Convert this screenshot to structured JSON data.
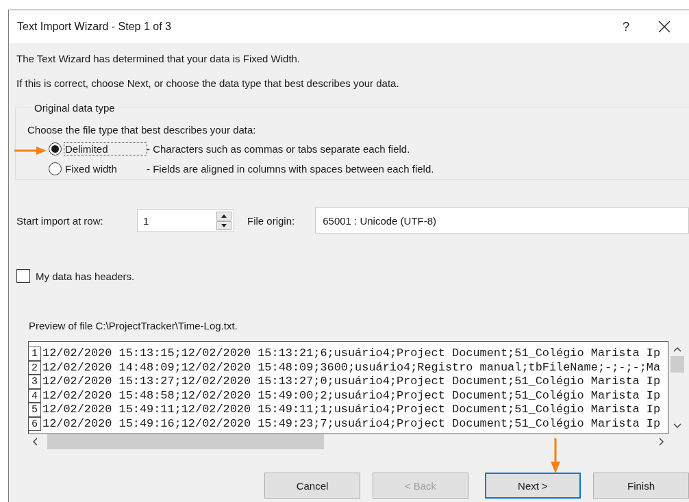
{
  "window": {
    "title": "Text Import Wizard - Step 1 of 3",
    "help": "?"
  },
  "intro": [
    "The Text Wizard has determined that your data is Fixed Width.",
    "If this is correct, choose Next, or choose the data type that best describes your data."
  ],
  "group": {
    "legend": "Original data type",
    "prompt": "Choose the file type that best describes your data:",
    "options": [
      {
        "label": "Delimited",
        "description": "- Characters such as commas or tabs separate each field.",
        "selected": true
      },
      {
        "label": "Fixed width",
        "description": "- Fields are aligned in columns with spaces between each field.",
        "selected": false
      }
    ]
  },
  "start_row": {
    "label": "Start import at row:",
    "value": "1"
  },
  "file_origin": {
    "label": "File origin:",
    "value": "65001 : Unicode (UTF-8)"
  },
  "headers_checkbox": {
    "label": "My data has headers.",
    "checked": false
  },
  "preview": {
    "label": "Preview of file C:\\ProjectTracker\\Time-Log.txt.",
    "rows": [
      {
        "number": "1",
        "text": "12/02/2020 15:13:15;12/02/2020 15:13:21;6;usuário4;Project Document;51_Colégio Marista Ip"
      },
      {
        "number": "2",
        "text": "12/02/2020 14:48:09;12/02/2020 15:48:09;3600;usuário4;Registro manual;tbFileName;-;-;-;Ma"
      },
      {
        "number": "3",
        "text": "12/02/2020 15:13:27;12/02/2020 15:13:27;0;usuário4;Project Document;51_Colégio Marista Ip"
      },
      {
        "number": "4",
        "text": "12/02/2020 15:48:58;12/02/2020 15:49:00;2;usuário4;Project Document;51_Colégio Marista Ip"
      },
      {
        "number": "5",
        "text": "12/02/2020 15:49:11;12/02/2020 15:49:11;1;usuário4;Project Document;51_Colégio Marista Ip"
      },
      {
        "number": "6",
        "text": "12/02/2020 15:49:16;12/02/2020 15:49:23;7;usuário4;Project Document;51_Colégio Marista Ip"
      }
    ]
  },
  "buttons": [
    {
      "label": "Cancel",
      "disabled": false,
      "focused": false
    },
    {
      "label": "< Back",
      "disabled": true,
      "focused": false
    },
    {
      "label": "Next >",
      "disabled": false,
      "focused": true
    },
    {
      "label": "Finish",
      "disabled": false,
      "focused": false
    }
  ]
}
